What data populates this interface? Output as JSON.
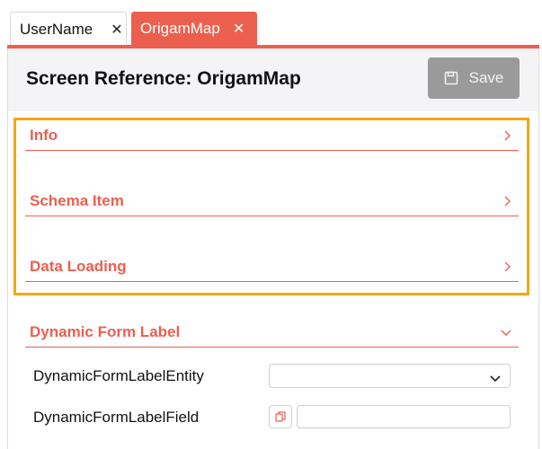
{
  "tabs": [
    {
      "label": "UserName",
      "close_icon": "close-icon",
      "active": false
    },
    {
      "label": "OrigamMap",
      "close_icon": "close-icon",
      "active": true
    }
  ],
  "header": {
    "title": "Screen Reference: OrigamMap",
    "save_label": "Save",
    "save_icon": "save-icon"
  },
  "sections": [
    {
      "label": "Info",
      "state": "collapsed"
    },
    {
      "label": "Schema Item",
      "state": "collapsed"
    },
    {
      "label": "Data Loading",
      "state": "collapsed"
    },
    {
      "label": "Dynamic Form Label",
      "state": "expanded"
    }
  ],
  "fields": {
    "entity_label": "DynamicFormLabelEntity",
    "entity_value": "",
    "field_label": "DynamicFormLabelField",
    "field_value": ""
  },
  "colors": {
    "accent": "#ec5f4f",
    "highlight": "#f4a712",
    "save_disabled": "#9a9a9a"
  }
}
